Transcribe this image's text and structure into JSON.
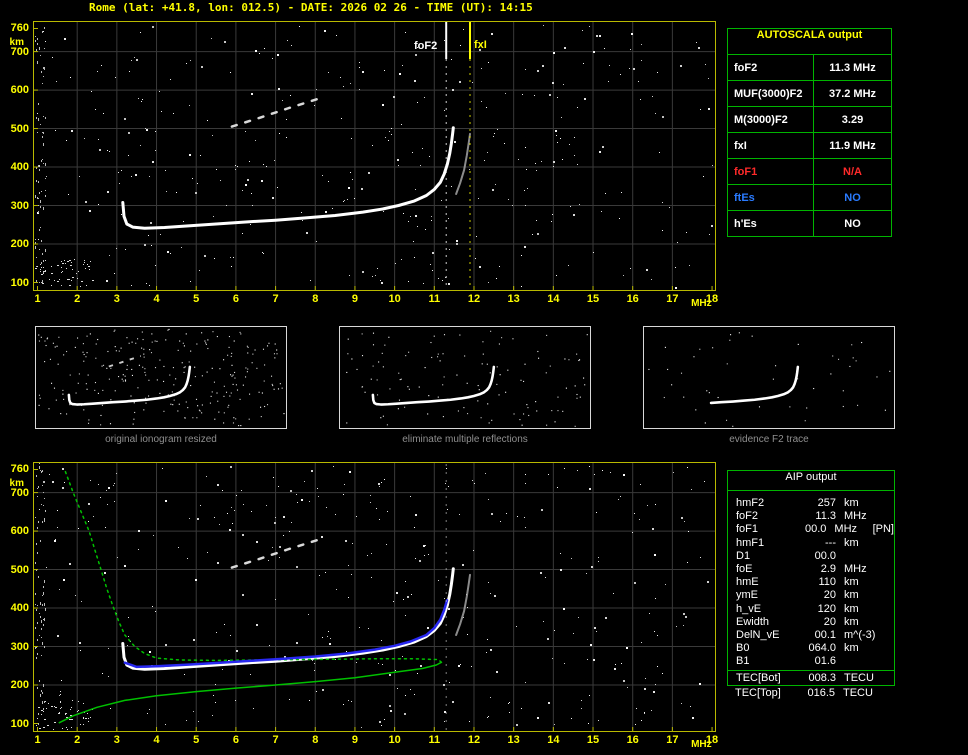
{
  "header": {
    "title": "Rome (lat: +41.8, lon: 012.5) - DATE: 2026 02 26 - TIME (UT): 14:15"
  },
  "colors": {
    "accent_yellow": "#ffff00",
    "axis_yellow": "#b9b900",
    "grid_gray": "#3a3a3a",
    "table_green": "#00b400",
    "alert_red": "#ff2a2a",
    "info_blue": "#2a7bff",
    "trace_white": "#ffffff",
    "restored_blue": "#2828f0",
    "profile_green": "#00c000"
  },
  "autoscala": {
    "title": "AUTOSCALA output",
    "rows": [
      {
        "label": "foF2",
        "value": "11.3 MHz",
        "color": "#ffffff"
      },
      {
        "label": "MUF(3000)F2",
        "value": "37.2 MHz",
        "color": "#ffffff"
      },
      {
        "label": "M(3000)F2",
        "value": "3.29",
        "color": "#ffffff"
      },
      {
        "label": "fxI",
        "value": "11.9 MHz",
        "color": "#ffffff"
      },
      {
        "label": "foF1",
        "value": "N/A",
        "color": "#ff2a2a"
      },
      {
        "label": "ftEs",
        "value": "NO",
        "color": "#2a7bff"
      },
      {
        "label": "h'Es",
        "value": "NO",
        "color": "#ffffff"
      }
    ]
  },
  "aip": {
    "title": "AIP output",
    "rows": [
      {
        "label": "hmF2",
        "value": "257",
        "unit": "km",
        "note": ""
      },
      {
        "label": "foF2",
        "value": "11.3",
        "unit": "MHz",
        "note": ""
      },
      {
        "label": "foF1",
        "value": "00.0",
        "unit": "MHz",
        "note": "[PN]"
      },
      {
        "label": "hmF1",
        "value": "---",
        "unit": "km",
        "note": ""
      },
      {
        "label": "D1",
        "value": "00.0",
        "unit": "",
        "note": ""
      },
      {
        "label": "foE",
        "value": "2.9",
        "unit": "MHz",
        "note": ""
      },
      {
        "label": "hmE",
        "value": "110",
        "unit": "km",
        "note": ""
      },
      {
        "label": "ymE",
        "value": "20",
        "unit": "km",
        "note": ""
      },
      {
        "label": "h_vE",
        "value": "120",
        "unit": "km",
        "note": ""
      },
      {
        "label": "Ewidth",
        "value": "20",
        "unit": "km",
        "note": ""
      },
      {
        "label": "DelN_vE",
        "value": "00.1",
        "unit": "m^(-3)",
        "note": ""
      },
      {
        "label": "B0",
        "value": "064.0",
        "unit": "km",
        "note": ""
      },
      {
        "label": "B1",
        "value": "01.6",
        "unit": "",
        "note": ""
      }
    ],
    "tec_rows": [
      {
        "label": "TEC[Bot]",
        "value": "008.3",
        "unit": "TECU"
      },
      {
        "label": "TEC[Top]",
        "value": "016.5",
        "unit": "TECU"
      }
    ]
  },
  "thumbnails": [
    {
      "caption": "original ionogram resized"
    },
    {
      "caption": "eliminate multiple reflections"
    },
    {
      "caption": "evidence F2 trace"
    }
  ],
  "chart_data": [
    {
      "type": "scatter",
      "title": "recorded ionogram (virtual height vs frequency)",
      "xlabel": "MHz",
      "ylabel": "km",
      "xlim": [
        1,
        18
      ],
      "ylim": [
        100,
        760
      ],
      "x_ticks": [
        1,
        2,
        3,
        4,
        5,
        6,
        7,
        8,
        9,
        10,
        11,
        12,
        13,
        14,
        15,
        16,
        17,
        18
      ],
      "y_ticks": [
        760,
        700,
        600,
        500,
        400,
        300,
        200,
        100
      ],
      "grid": true,
      "noise": {
        "seed": 7,
        "count": 380
      },
      "markers": [
        {
          "label": "foF2",
          "freq_mhz": 11.3,
          "color": "#ffffff",
          "bright": true
        },
        {
          "label": "fxI",
          "freq_mhz": 11.9,
          "color": "#ffff00",
          "bright": true
        }
      ],
      "series": [
        {
          "name": "O-mode trace",
          "color": "#ffffff",
          "width": 3,
          "points": [
            [
              3.15,
              308
            ],
            [
              3.18,
              272
            ],
            [
              3.25,
              252
            ],
            [
              3.4,
              244
            ],
            [
              3.7,
              241
            ],
            [
              4.2,
              243
            ],
            [
              4.8,
              247
            ],
            [
              5.5,
              252
            ],
            [
              6.2,
              257
            ],
            [
              7.0,
              262
            ],
            [
              7.8,
              268
            ],
            [
              8.5,
              274
            ],
            [
              9.2,
              283
            ],
            [
              9.7,
              291
            ],
            [
              10.1,
              300
            ],
            [
              10.5,
              312
            ],
            [
              10.8,
              326
            ],
            [
              11.0,
              342
            ],
            [
              11.15,
              360
            ],
            [
              11.25,
              382
            ],
            [
              11.33,
              408
            ],
            [
              11.39,
              436
            ],
            [
              11.43,
              462
            ],
            [
              11.46,
              486
            ],
            [
              11.48,
              502
            ]
          ]
        },
        {
          "name": "second hop echo",
          "color": "#d8d8d8",
          "width": 2.5,
          "style": "dashed",
          "points": [
            [
              5.9,
              505
            ],
            [
              6.6,
              528
            ],
            [
              7.3,
              552
            ],
            [
              8.1,
              578
            ]
          ]
        },
        {
          "name": "X-mode trace",
          "color": "#b9b9b9",
          "width": 2,
          "opacity": 0.75,
          "points": [
            [
              11.55,
              330
            ],
            [
              11.65,
              358
            ],
            [
              11.75,
              392
            ],
            [
              11.82,
              430
            ],
            [
              11.87,
              464
            ],
            [
              11.9,
              486
            ]
          ]
        }
      ]
    },
    {
      "type": "scatter",
      "title": "ionogram with restored trace and electron density profile",
      "xlabel": "MHz",
      "ylabel": "km",
      "xlim": [
        1,
        18
      ],
      "ylim": [
        100,
        760
      ],
      "x_ticks": [
        1,
        2,
        3,
        4,
        5,
        6,
        7,
        8,
        9,
        10,
        11,
        12,
        13,
        14,
        15,
        16,
        17,
        18
      ],
      "y_ticks": [
        760,
        700,
        600,
        500,
        400,
        300,
        200,
        100
      ],
      "grid": true,
      "noise": {
        "seed": 13,
        "count": 380
      },
      "markers": [
        {
          "label": "",
          "freq_mhz": 11.3,
          "color": "#ffffff",
          "bright": false
        }
      ],
      "series": [
        {
          "name": "O-mode trace",
          "color": "#ffffff",
          "width": 3,
          "points": [
            [
              3.15,
              308
            ],
            [
              3.18,
              272
            ],
            [
              3.25,
              252
            ],
            [
              3.4,
              244
            ],
            [
              3.7,
              241
            ],
            [
              4.2,
              243
            ],
            [
              4.8,
              247
            ],
            [
              5.5,
              252
            ],
            [
              6.2,
              257
            ],
            [
              7.0,
              262
            ],
            [
              7.8,
              268
            ],
            [
              8.5,
              274
            ],
            [
              9.2,
              283
            ],
            [
              9.7,
              291
            ],
            [
              10.1,
              300
            ],
            [
              10.5,
              312
            ],
            [
              10.8,
              326
            ],
            [
              11.0,
              342
            ],
            [
              11.15,
              360
            ],
            [
              11.25,
              382
            ],
            [
              11.33,
              408
            ],
            [
              11.39,
              436
            ],
            [
              11.43,
              462
            ],
            [
              11.46,
              486
            ],
            [
              11.48,
              502
            ]
          ]
        },
        {
          "name": "second hop echo",
          "color": "#d8d8d8",
          "width": 2.5,
          "style": "dashed",
          "points": [
            [
              5.9,
              505
            ],
            [
              6.6,
              528
            ],
            [
              7.3,
              552
            ],
            [
              8.1,
              578
            ]
          ]
        },
        {
          "name": "X-mode trace",
          "color": "#b9b9b9",
          "width": 2,
          "opacity": 0.75,
          "points": [
            [
              11.55,
              330
            ],
            [
              11.65,
              358
            ],
            [
              11.75,
              392
            ],
            [
              11.82,
              430
            ],
            [
              11.87,
              464
            ],
            [
              11.9,
              486
            ]
          ]
        },
        {
          "name": "profile topside",
          "color": "#00c000",
          "width": 1.5,
          "style": "dotted",
          "points": [
            [
              11.18,
              259
            ],
            [
              11.1,
              266
            ],
            [
              10.5,
              268
            ],
            [
              9.5,
              268
            ],
            [
              8.5,
              267
            ],
            [
              7.5,
              266
            ],
            [
              6.5,
              265
            ],
            [
              5.5,
              264
            ],
            [
              4.6,
              265
            ],
            [
              4.0,
              270
            ],
            [
              3.7,
              282
            ],
            [
              3.45,
              300
            ],
            [
              3.2,
              330
            ],
            [
              3.05,
              365
            ],
            [
              2.9,
              405
            ],
            [
              2.75,
              450
            ],
            [
              2.6,
              500
            ],
            [
              2.45,
              550
            ],
            [
              2.3,
              600
            ],
            [
              2.1,
              650
            ],
            [
              1.9,
              700
            ],
            [
              1.7,
              755
            ]
          ]
        },
        {
          "name": "profile bottomside",
          "color": "#00c000",
          "width": 1.5,
          "points": [
            [
              1.55,
              102
            ],
            [
              1.9,
              120
            ],
            [
              2.5,
              142
            ],
            [
              3.2,
              160
            ],
            [
              4.0,
              172
            ],
            [
              5.0,
              183
            ],
            [
              6.0,
              192
            ],
            [
              7.0,
              200
            ],
            [
              8.0,
              209
            ],
            [
              9.0,
              219
            ],
            [
              10.0,
              233
            ],
            [
              10.7,
              243
            ],
            [
              11.05,
              252
            ],
            [
              11.18,
              259
            ]
          ]
        },
        {
          "name": "restored trace",
          "color": "#2828f0",
          "width": 2.5,
          "points": [
            [
              3.2,
              258
            ],
            [
              3.5,
              247
            ],
            [
              4.0,
              249
            ],
            [
              4.8,
              253
            ],
            [
              5.6,
              258
            ],
            [
              6.4,
              263
            ],
            [
              7.2,
              268
            ],
            [
              8.0,
              274
            ],
            [
              8.8,
              282
            ],
            [
              9.5,
              292
            ],
            [
              10.0,
              302
            ],
            [
              10.4,
              313
            ],
            [
              10.8,
              330
            ],
            [
              11.0,
              348
            ],
            [
              11.15,
              370
            ],
            [
              11.25,
              395
            ],
            [
              11.32,
              420
            ]
          ]
        }
      ]
    }
  ]
}
